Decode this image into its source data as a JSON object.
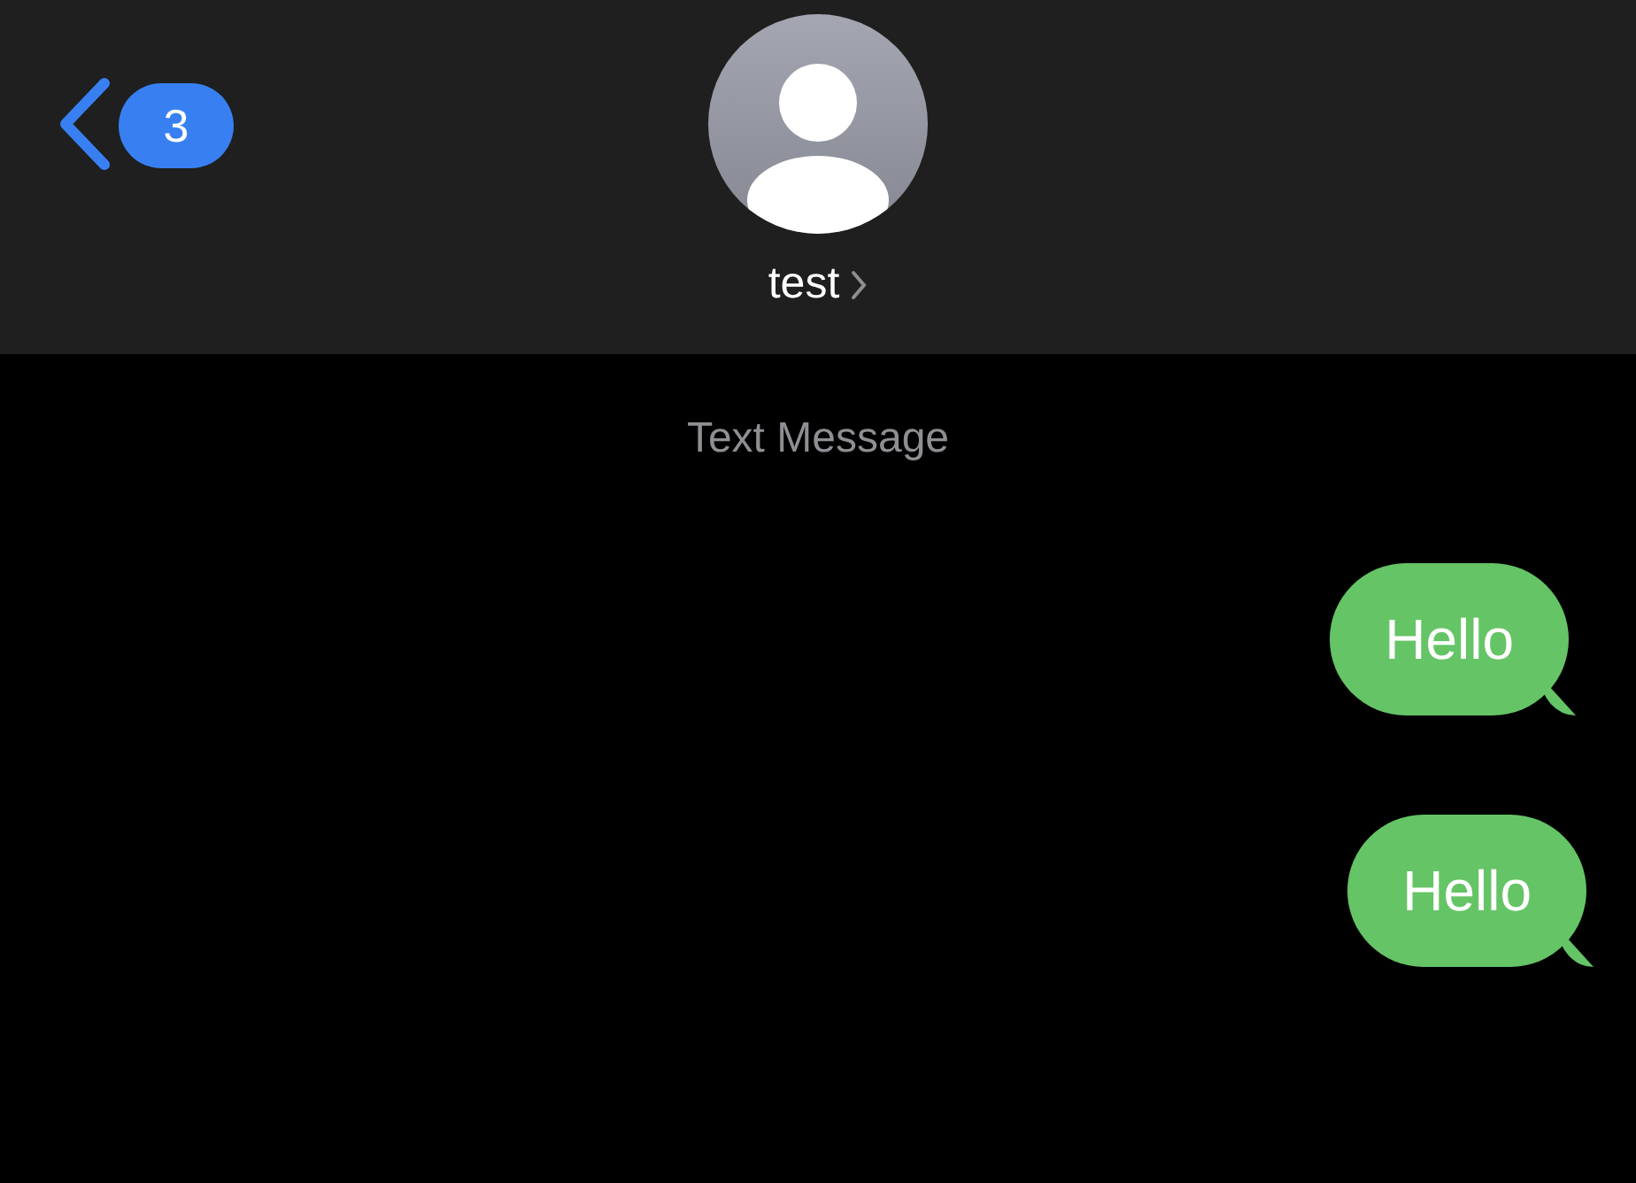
{
  "header": {
    "back_badge": "3",
    "contact_name": "test"
  },
  "conversation": {
    "service_label": "Text Message",
    "messages": [
      {
        "text": "Hello",
        "kind": "sent"
      },
      {
        "text": "Hello",
        "kind": "sent"
      }
    ]
  }
}
